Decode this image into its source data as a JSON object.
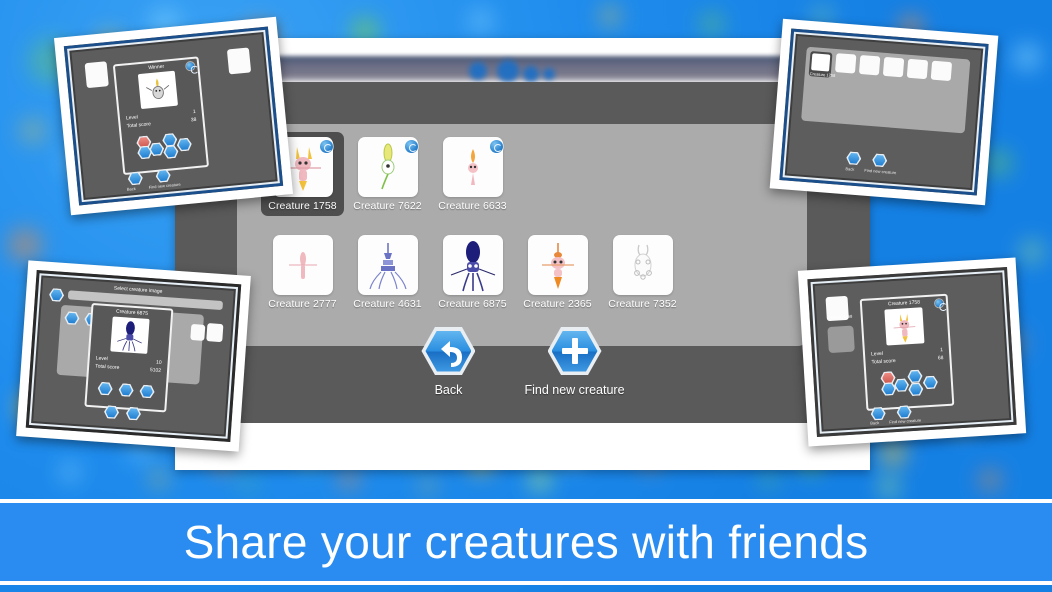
{
  "background": {
    "color": "#1f8ced",
    "bokeh_colors": [
      "#7ad14a",
      "#f2c63c",
      "#8ad8ff",
      "#f08a3c",
      "#bff07a"
    ]
  },
  "app": {
    "header_logo": "app-logo-blurred",
    "panel_color": "#ababab",
    "body_color": "#5a5a5a"
  },
  "creatures": {
    "row1": [
      {
        "label": "Creature 1758",
        "selected": true,
        "badge": true,
        "art": "pink-horned"
      },
      {
        "label": "Creature 7622",
        "selected": false,
        "badge": true,
        "art": "green-sprout"
      },
      {
        "label": "Creature 6633",
        "selected": false,
        "badge": true,
        "art": "orange-flame"
      }
    ],
    "row2": [
      {
        "label": "Creature 2777",
        "selected": false,
        "badge": false,
        "art": "pink-thin"
      },
      {
        "label": "Creature 4631",
        "selected": false,
        "badge": false,
        "art": "blue-tower"
      },
      {
        "label": "Creature 6875",
        "selected": false,
        "badge": false,
        "art": "navy-squid"
      },
      {
        "label": "Creature 2365",
        "selected": false,
        "badge": false,
        "art": "orange-bot"
      },
      {
        "label": "Creature 7352",
        "selected": false,
        "badge": false,
        "art": "white-ghost"
      }
    ]
  },
  "actions": [
    {
      "label": "Back",
      "icon": "back-arrow-icon"
    },
    {
      "label": "Find new creature",
      "icon": "plus-icon"
    }
  ],
  "cards": {
    "top_left": {
      "name": "winner-dialog-card",
      "dialog_title": "Winner",
      "stat_level_label": "Level",
      "stat_level_value": "1",
      "stat_score_label": "Total score",
      "stat_score_value": "38",
      "footer_left": "Back",
      "footer_right": "Find new creature"
    },
    "top_right": {
      "name": "creature-grid-card",
      "selected_tile": "Creature 1758",
      "footer_left": "Back",
      "footer_right": "Find new creature"
    },
    "bottom_left": {
      "name": "select-creature-image-card",
      "screen_title": "Select creature image",
      "dialog_title": "Creature 6875",
      "stat_level_label": "Level",
      "stat_level_value": "10",
      "stat_score_label": "Total score",
      "stat_score_value": "5102"
    },
    "bottom_right": {
      "name": "creature-detail-card",
      "dialog_title": "Creature 1758",
      "stat_level_label": "Level",
      "stat_level_value": "1",
      "stat_score_label": "Total score",
      "stat_score_value": "68",
      "footer_left": "Back",
      "footer_right": "Find new creature"
    }
  },
  "banner": {
    "text": "Share your creatures with friends",
    "bg_color": "#2a8cf0",
    "text_color": "#ffffff"
  }
}
